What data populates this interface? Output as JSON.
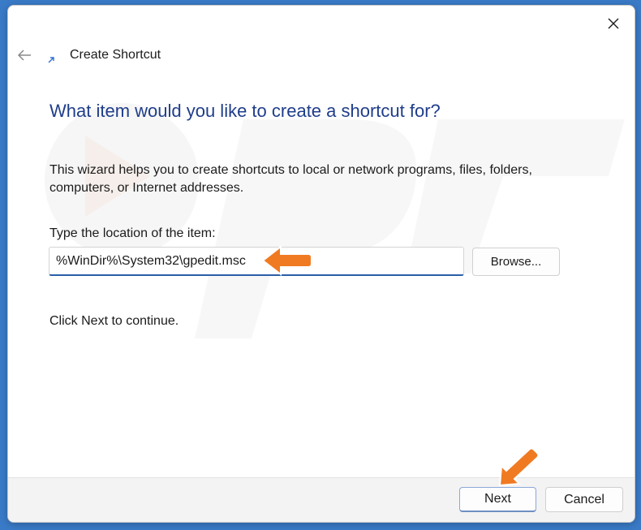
{
  "window": {
    "title": "Create Shortcut",
    "close_icon": "close-icon",
    "back_icon": "back-arrow-icon",
    "title_icon": "shortcut-arrow-icon"
  },
  "main": {
    "heading": "What item would you like to create a shortcut for?",
    "description": "This wizard helps you to create shortcuts to local or network programs, files, folders, computers, or Internet addresses.",
    "field_label": "Type the location of the item:",
    "location_value": "%WinDir%\\System32\\gpedit.msc",
    "browse_label": "Browse...",
    "hint": "Click Next to continue."
  },
  "footer": {
    "next_label": "Next",
    "cancel_label": "Cancel"
  },
  "colors": {
    "heading": "#1f3d8a",
    "accent_underline": "#2a5ea8",
    "annotation_arrow": "#f07a22",
    "backdrop": "#3a7bc8"
  }
}
